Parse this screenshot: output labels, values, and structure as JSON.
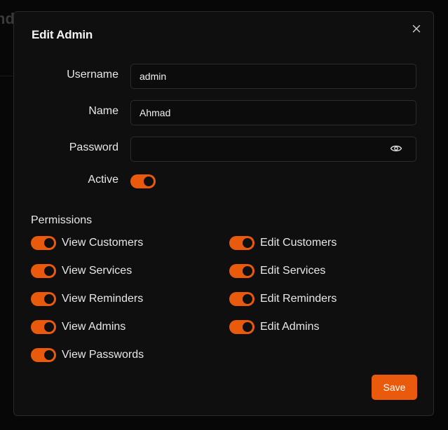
{
  "background": {
    "title_fragment": "nd"
  },
  "dialog": {
    "title": "Edit Admin",
    "close_icon": "close-icon",
    "fields": {
      "username": {
        "label": "Username",
        "value": "admin"
      },
      "name": {
        "label": "Name",
        "value": "Ahmad"
      },
      "password": {
        "label": "Password",
        "value": "",
        "icon": "eye-icon"
      },
      "active": {
        "label": "Active",
        "checked": true
      }
    },
    "permissions": {
      "title": "Permissions",
      "items": [
        {
          "label": "View Customers",
          "checked": true
        },
        {
          "label": "Edit Customers",
          "checked": true
        },
        {
          "label": "View Services",
          "checked": true
        },
        {
          "label": "Edit Services",
          "checked": true
        },
        {
          "label": "View Reminders",
          "checked": true
        },
        {
          "label": "Edit Reminders",
          "checked": true
        },
        {
          "label": "View Admins",
          "checked": true
        },
        {
          "label": "Edit Admins",
          "checked": true
        },
        {
          "label": "View Passwords",
          "checked": true
        }
      ]
    },
    "save_label": "Save"
  },
  "colors": {
    "accent": "#ea5a0c",
    "surface": "#0f0f0f",
    "page_bg": "#070707",
    "border": "#2a2a2a",
    "text": "#e8e8e8"
  }
}
